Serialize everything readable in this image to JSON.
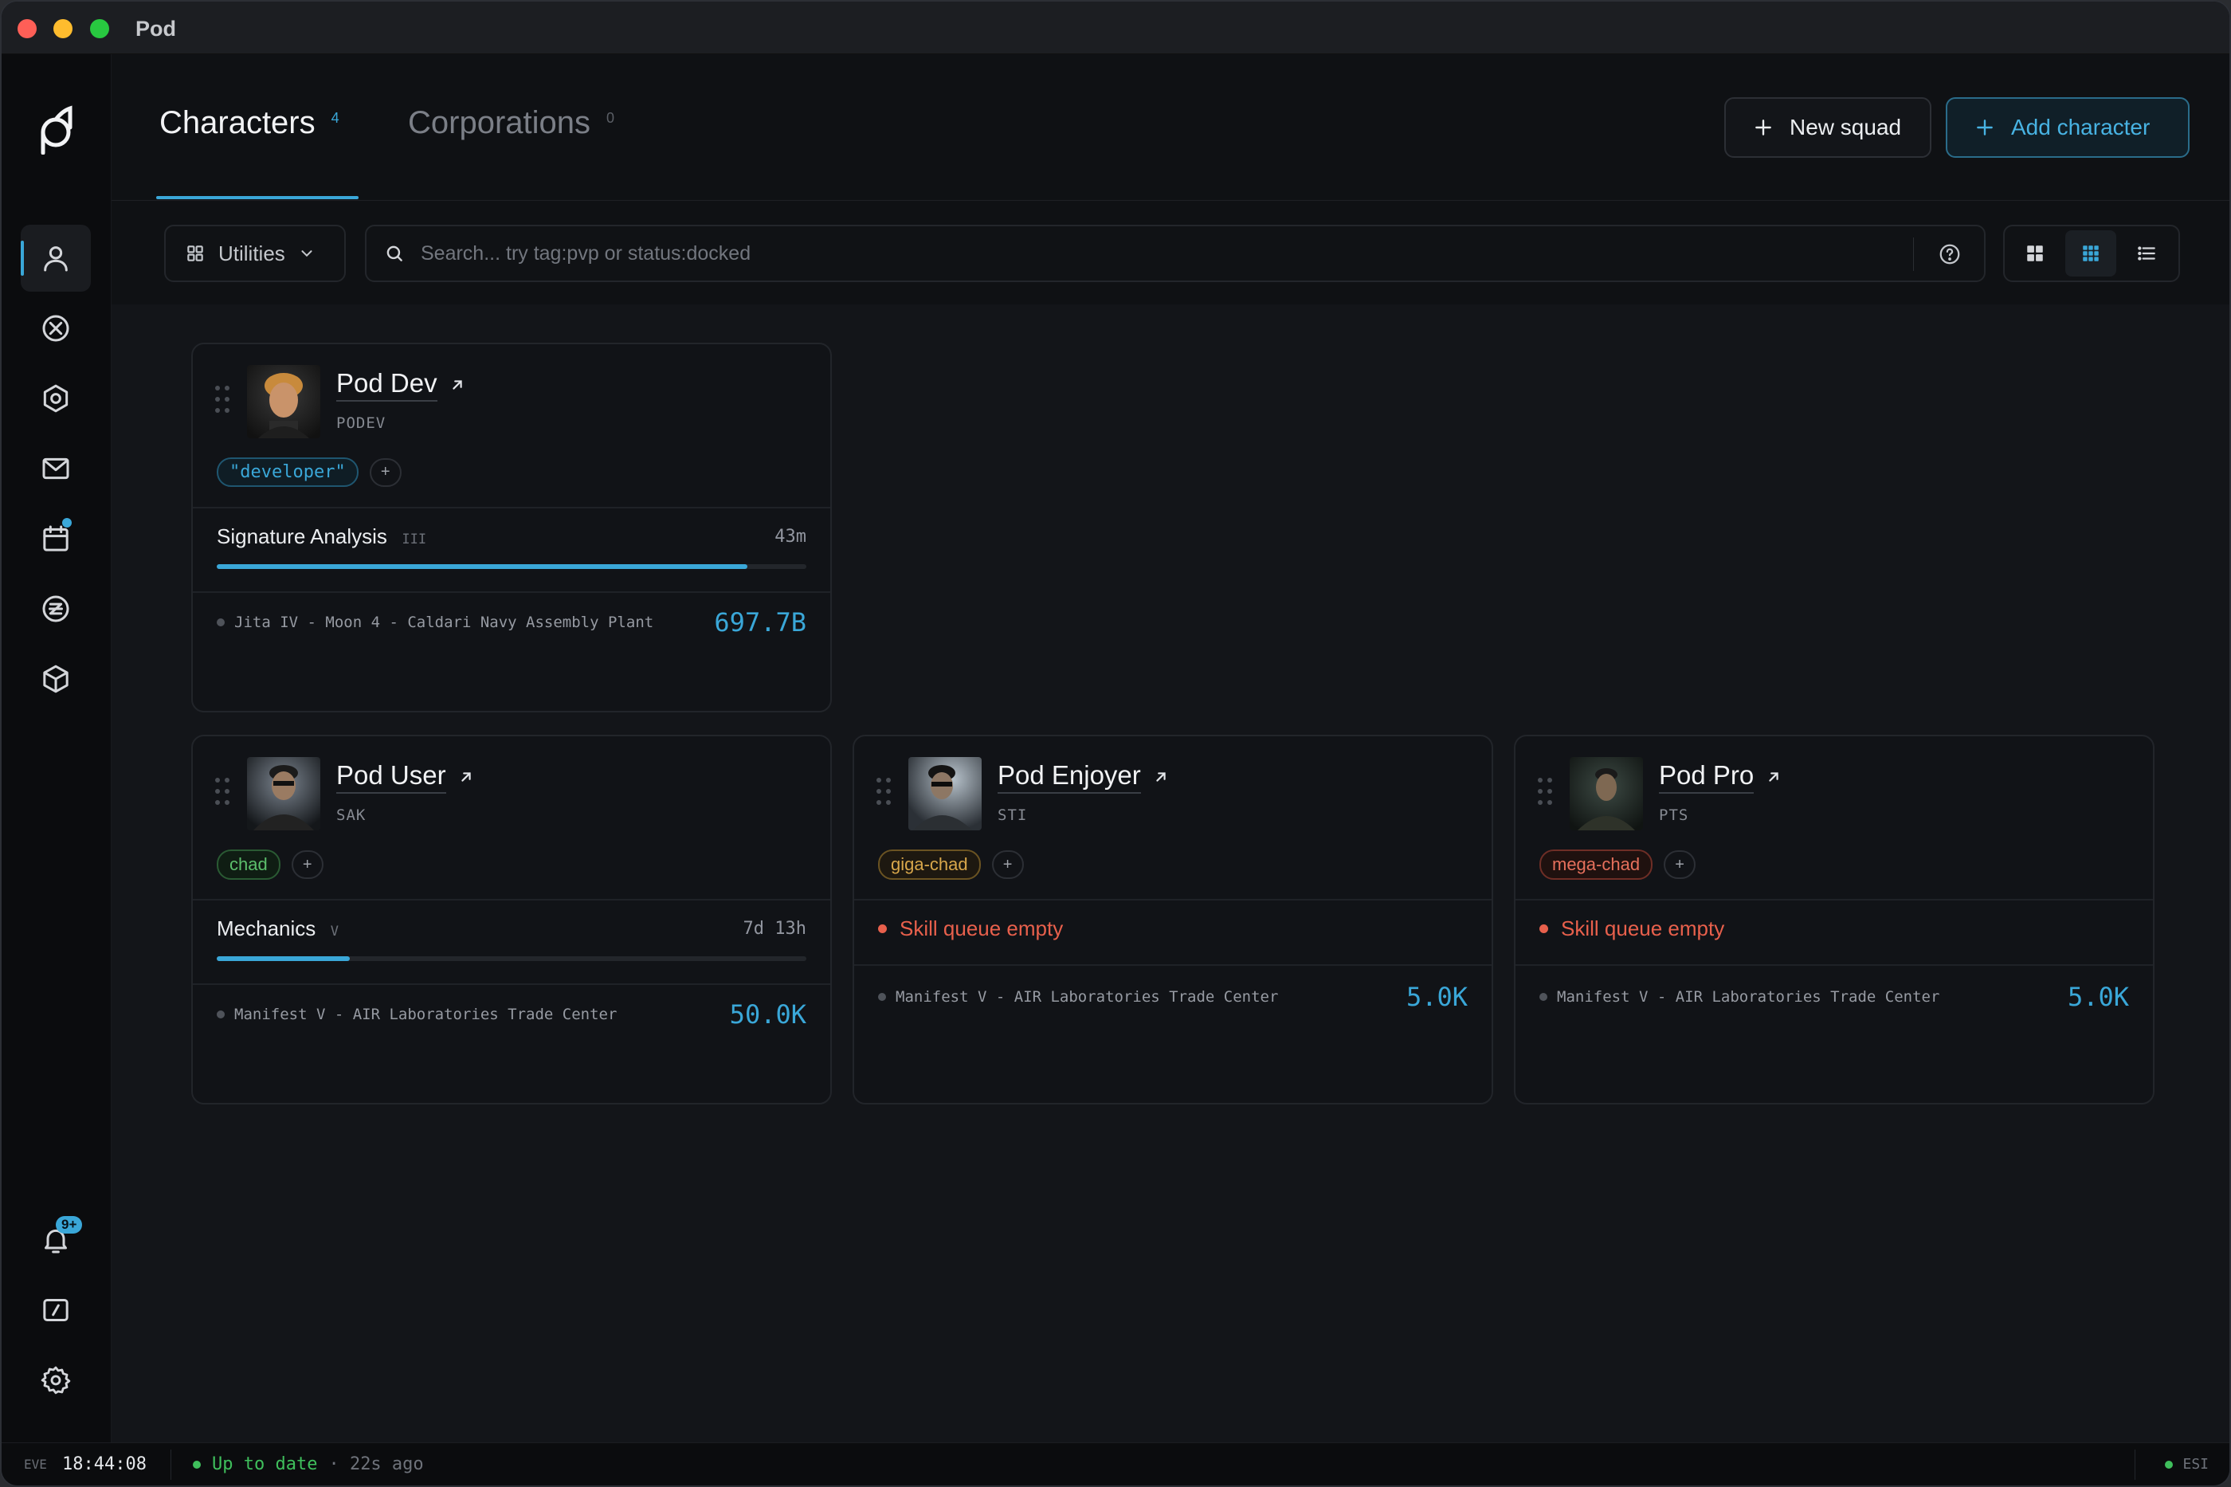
{
  "window": {
    "title": "Pod"
  },
  "header": {
    "tabs": [
      {
        "label": "Characters",
        "count": "4"
      },
      {
        "label": "Corporations",
        "count": "0"
      }
    ],
    "new_squad_label": "New squad",
    "add_character_label": "Add character"
  },
  "toolbar": {
    "utilities_label": "Utilities",
    "search_placeholder": "Search... try tag:pvp or status:docked",
    "view_modes": [
      "grid-large",
      "grid-small",
      "list"
    ],
    "active_view": "grid-small"
  },
  "sidebar": {
    "items": [
      {
        "name": "characters",
        "icon": "user-icon",
        "active": true
      },
      {
        "name": "fleet",
        "icon": "crosshair-circle-icon"
      },
      {
        "name": "fittings",
        "icon": "hexagon-icon"
      },
      {
        "name": "mail",
        "icon": "mail-icon"
      },
      {
        "name": "calendar",
        "icon": "calendar-icon",
        "has_dot": true
      },
      {
        "name": "wallet",
        "icon": "currency-icon"
      },
      {
        "name": "assets",
        "icon": "cube-icon"
      }
    ],
    "bottom": {
      "notifications_badge": "9+"
    }
  },
  "characters": [
    {
      "name": "Pod Dev",
      "ticker": "PODEV",
      "tags": [
        {
          "label": "\"developer\"",
          "color": "blue"
        }
      ],
      "skill": {
        "name": "Signature Analysis",
        "level": "III",
        "time": "43m",
        "progress": 0.9
      },
      "location": "Jita IV - Moon 4 - Caldari Navy Assembly Plant",
      "isk": "697.7B"
    },
    {
      "name": "Pod User",
      "ticker": "SAK",
      "tags": [
        {
          "label": "chad",
          "color": "green"
        }
      ],
      "skill": {
        "name": "Mechanics",
        "level": "V",
        "time": "7d 13h",
        "progress": 0.225
      },
      "location": "Manifest V - AIR Laboratories Trade Center",
      "isk": "50.0K"
    },
    {
      "name": "Pod Enjoyer",
      "ticker": "STI",
      "tags": [
        {
          "label": "giga-chad",
          "color": "amber"
        }
      ],
      "warning": "Skill queue empty",
      "location": "Manifest V - AIR Laboratories Trade Center",
      "isk": "5.0K"
    },
    {
      "name": "Pod Pro",
      "ticker": "PTS",
      "tags": [
        {
          "label": "mega-chad",
          "color": "red"
        }
      ],
      "warning": "Skill queue empty",
      "location": "Manifest V - AIR Laboratories Trade Center",
      "isk": "5.0K"
    }
  ],
  "statusbar": {
    "eve_label": "EVE",
    "time": "18:44:08",
    "status": "Up to date",
    "ago": "· 22s ago",
    "esi_label": "ESI"
  },
  "colors": {
    "accent": "#3aa7d8",
    "warning": "#e8604c",
    "ok": "#3fbf5c"
  }
}
